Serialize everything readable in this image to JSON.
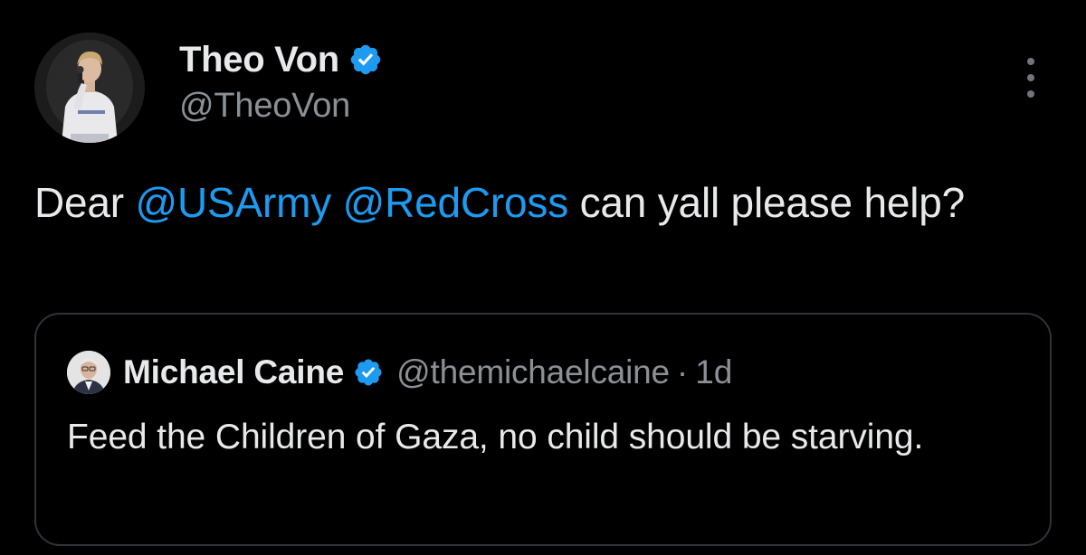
{
  "post": {
    "author": {
      "display_name": "Theo Von",
      "handle": "@TheoVon",
      "verified": true,
      "avatar_icon": "avatar-photo"
    },
    "more_icon": "more-options-icon",
    "text": {
      "prefix": "Dear ",
      "mentions": [
        "@USArmy",
        "@RedCross"
      ],
      "suffix": " can yall please help?"
    },
    "quoted": {
      "display_name": "Michael Caine",
      "handle": "@themichaelcaine",
      "separator": "·",
      "time": "1d",
      "verified": true,
      "text": "Feed the Children of Gaza, no child should be starving."
    }
  },
  "colors": {
    "background": "#000000",
    "text": "#e7e9ea",
    "secondary_text": "#8b9095",
    "mention": "#1d9bf0",
    "verified_badge": "#1d9bf0",
    "border": "#2f3336"
  }
}
